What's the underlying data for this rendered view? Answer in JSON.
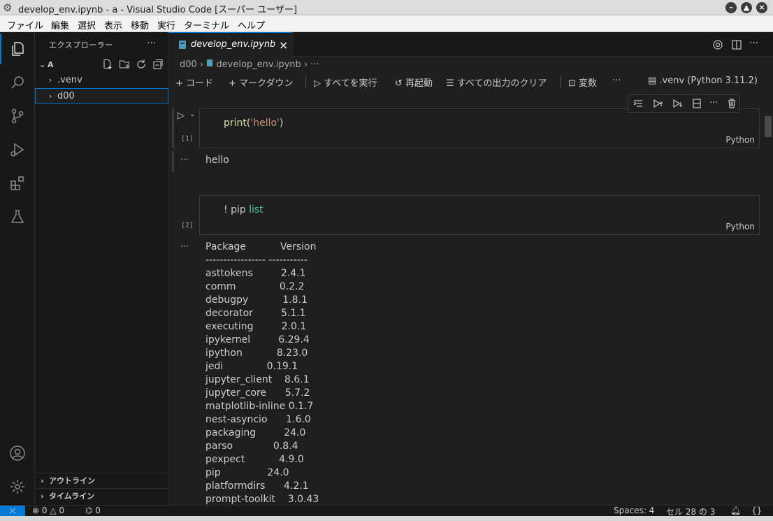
{
  "window": {
    "title": "develop_env.ipynb - a - Visual Studio Code [スーパー ユーザー]"
  },
  "menu": [
    "ファイル",
    "編集",
    "選択",
    "表示",
    "移動",
    "実行",
    "ターミナル",
    "ヘルプ"
  ],
  "sidebar": {
    "header": "エクスプローラー",
    "more": "···",
    "root": "A",
    "items": [
      ".venv",
      "d00"
    ],
    "sections": [
      "アウトライン",
      "タイムライン"
    ]
  },
  "tab": {
    "label": "develop_env.ipynb",
    "close": "×"
  },
  "breadcrumb": {
    "folder": "d00",
    "file": "develop_env.ipynb",
    "more": "···"
  },
  "toolbar": {
    "add_code": "+ コード",
    "add_markdown": "+ マークダウン",
    "run_all": "すべてを実行",
    "restart": "再起動",
    "clear_outputs": "すべての出力のクリア",
    "variables": "変数",
    "more": "···",
    "kernel": ".venv (Python 3.11.2)"
  },
  "cells": [
    {
      "exec_count": "[1]",
      "code_fn": "print(",
      "code_str": "'hello'",
      "code_close": ")",
      "language": "Python",
      "output": "hello"
    },
    {
      "exec_count": "[2]",
      "code_bang": "! pip ",
      "code_arg": "list",
      "language": "Python",
      "output_lines": [
        "Package           Version",
        "----------------- -----------",
        "asttokens         2.4.1",
        "comm              0.2.2",
        "debugpy           1.8.1",
        "decorator         5.1.1",
        "executing         2.0.1",
        "ipykernel         6.29.4",
        "ipython           8.23.0",
        "jedi              0.19.1",
        "jupyter_client    8.6.1",
        "jupyter_core      5.7.2",
        "matplotlib-inline 0.1.7",
        "nest-asyncio      1.6.0",
        "packaging         24.0",
        "parso             0.8.4",
        "pexpect           4.9.0",
        "pip               24.0",
        "platformdirs      4.2.1",
        "prompt-toolkit    3.0.43"
      ]
    }
  ],
  "output_more": "···",
  "status": {
    "remote": "⤫",
    "problems": "⊗ 0 △ 0",
    "ports": "0",
    "spaces": "Spaces: 4",
    "cell": "セル 28 の 3"
  },
  "colors": {
    "accent": "#0078d4",
    "string": "#ce9178",
    "function": "#dcdcaa",
    "builtin": "#4ec9b0"
  }
}
